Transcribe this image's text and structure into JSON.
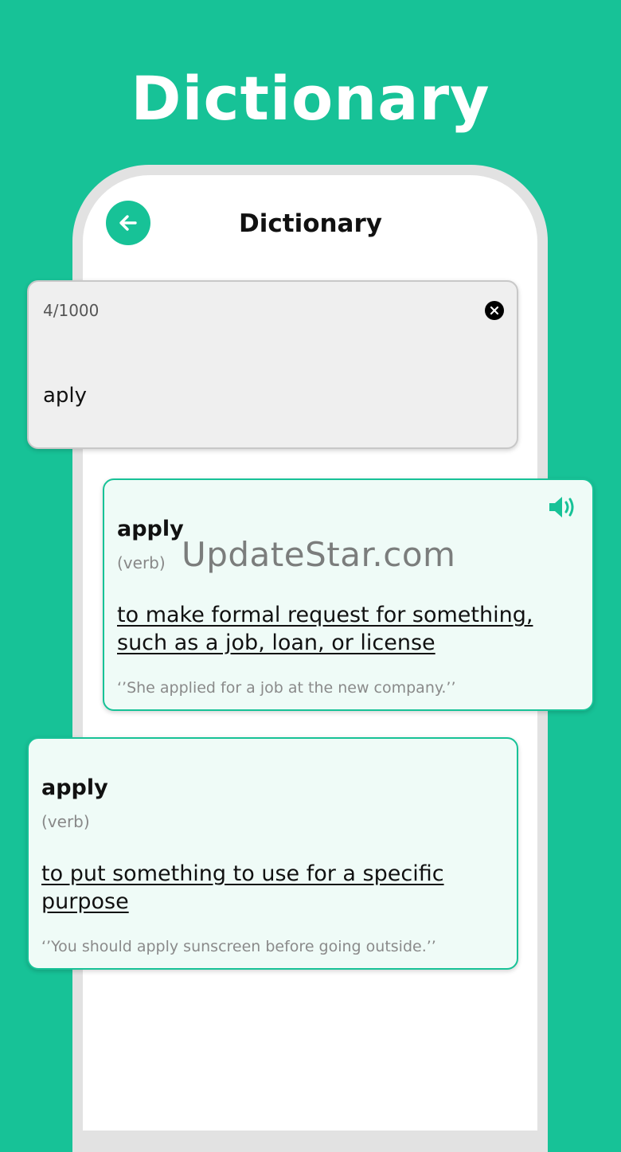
{
  "headline": "Dictionary",
  "screen": {
    "title": "Dictionary",
    "back_icon": "arrow-left-icon"
  },
  "input": {
    "counter": "4/1000",
    "query": "aply",
    "clear_icon": "close-circle-icon"
  },
  "results": [
    {
      "word": "apply",
      "pos": "(verb)",
      "meaning": "to make formal request for something, such as a job, loan, or license",
      "example": "‘’She applied for a job at the new company.’’",
      "speaker_icon": "speaker-icon"
    },
    {
      "word": "apply",
      "pos": "(verb)",
      "meaning": "to put something to use for a specific purpose",
      "example": "‘’You should apply sunscreen before going outside.’’"
    }
  ],
  "watermark": "UpdateStar.com",
  "colors": {
    "accent": "#17c297",
    "card_bg": "#effbf7",
    "input_bg": "#efefef"
  }
}
